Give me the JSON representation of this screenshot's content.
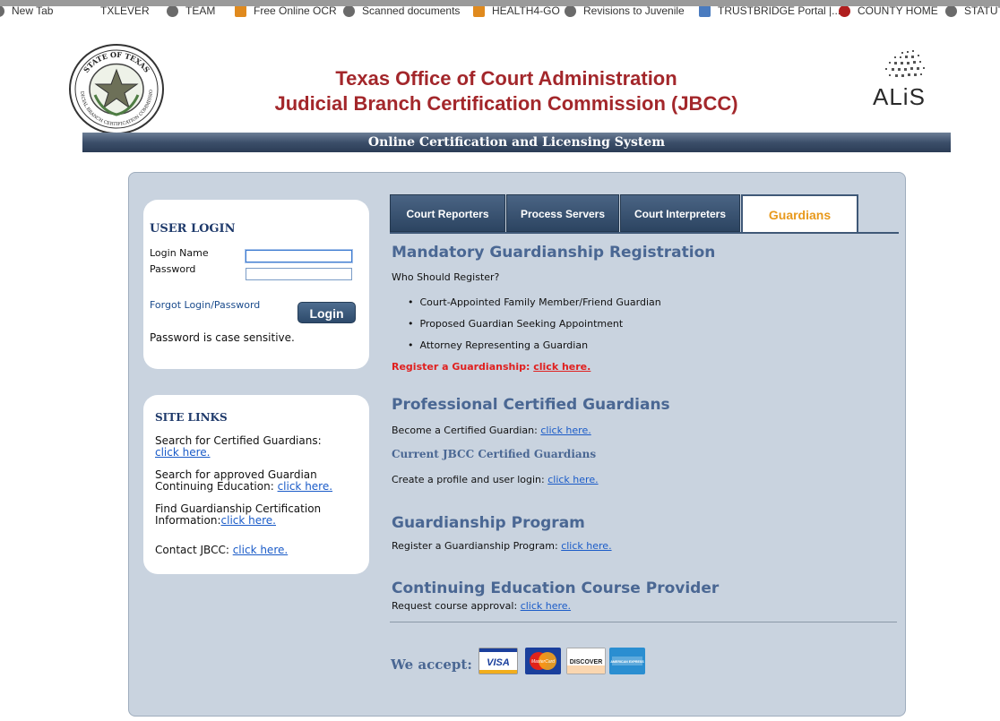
{
  "bookmarks": [
    {
      "label": "New Tab",
      "icon": "globe-icon"
    },
    {
      "label": "TXLEVER",
      "icon": "seal-icon"
    },
    {
      "label": "TEAM",
      "icon": "globe-icon"
    },
    {
      "label": "Free Online OCR",
      "icon": "ocr-icon"
    },
    {
      "label": "Scanned documents",
      "icon": "globe-icon"
    },
    {
      "label": "HEALTH4-GO",
      "icon": "health-icon"
    },
    {
      "label": "Revisions to Juvenile",
      "icon": "globe-icon"
    },
    {
      "label": "TRUSTBRIDGE Portal |...",
      "icon": "doc-icon"
    },
    {
      "label": "COUNTY HOME",
      "icon": "county-icon"
    },
    {
      "label": "STATUT",
      "icon": "globe-icon"
    }
  ],
  "header": {
    "line1": "Texas Office of Court Administration",
    "line2": "Judicial Branch Certification Commission (JBCC)",
    "seal_text_top": "STATE OF TEXAS",
    "seal_text_bottom": "JUDICIAL BRANCH CERTIFICATION COMMISSION",
    "alis_logo": "ALiS",
    "banner": "Online Certification and Licensing System"
  },
  "login": {
    "title": "USER LOGIN",
    "login_name_label": "Login Name",
    "password_label": "Password",
    "login_name_value": "",
    "password_value": "",
    "forgot_link": "Forgot Login/Password",
    "login_button": "Login",
    "case_note": "Password is case sensitive."
  },
  "site_links": {
    "title": "SITE LINKS",
    "items": [
      {
        "text": "Search for Certified Guardians:",
        "link": "click here."
      },
      {
        "text": "Search for approved Guardian Continuing Education:",
        "link": "click here."
      },
      {
        "text": "Find Guardianship Certification Information:",
        "link": "click here."
      },
      {
        "text": "Contact JBCC:",
        "link": "click here."
      }
    ]
  },
  "tabs": [
    {
      "label": "Court Reporters",
      "active": false
    },
    {
      "label": "Process Servers",
      "active": false
    },
    {
      "label": "Court Interpreters",
      "active": false
    },
    {
      "label": "Guardians",
      "active": true
    }
  ],
  "content": {
    "mandatory": {
      "heading": "Mandatory Guardianship Registration",
      "question": "Who Should Register?",
      "bullets": [
        "Court-Appointed Family Member/Friend Guardian",
        "Proposed Guardian Seeking Appointment",
        "Attorney Representing a Guardian"
      ],
      "register_text": "Register a Guardianship:",
      "register_link": "click here."
    },
    "professional": {
      "heading": "Professional Certified Guardians",
      "become_text": "Become a Certified Guardian:",
      "become_link": "click here.",
      "current_heading": "Current JBCC Certified Guardians",
      "profile_text": "Create a profile and user login:",
      "profile_link": "click here."
    },
    "program": {
      "heading": "Guardianship Program",
      "text": "Register a Guardianship Program:",
      "link": "click here."
    },
    "provider": {
      "heading": "Continuing Education Course Provider",
      "text": "Request course approval:",
      "link": "click here."
    },
    "accept_label": "We accept:",
    "cards": [
      {
        "name": "VISA",
        "color": "#ffffff"
      },
      {
        "name": "MasterCard",
        "color": "#1a3f9c"
      },
      {
        "name": "DISCOVER",
        "color": "#ffffff"
      },
      {
        "name": "AMERICAN EXPRESS",
        "color": "#2a8ed1"
      }
    ]
  },
  "colors": {
    "title_red": "#a3272b",
    "heading_blue": "#4a6793",
    "tab_active_text": "#e8991c",
    "panel_bg": "#c9d3df",
    "alert_red": "#e0201f"
  }
}
